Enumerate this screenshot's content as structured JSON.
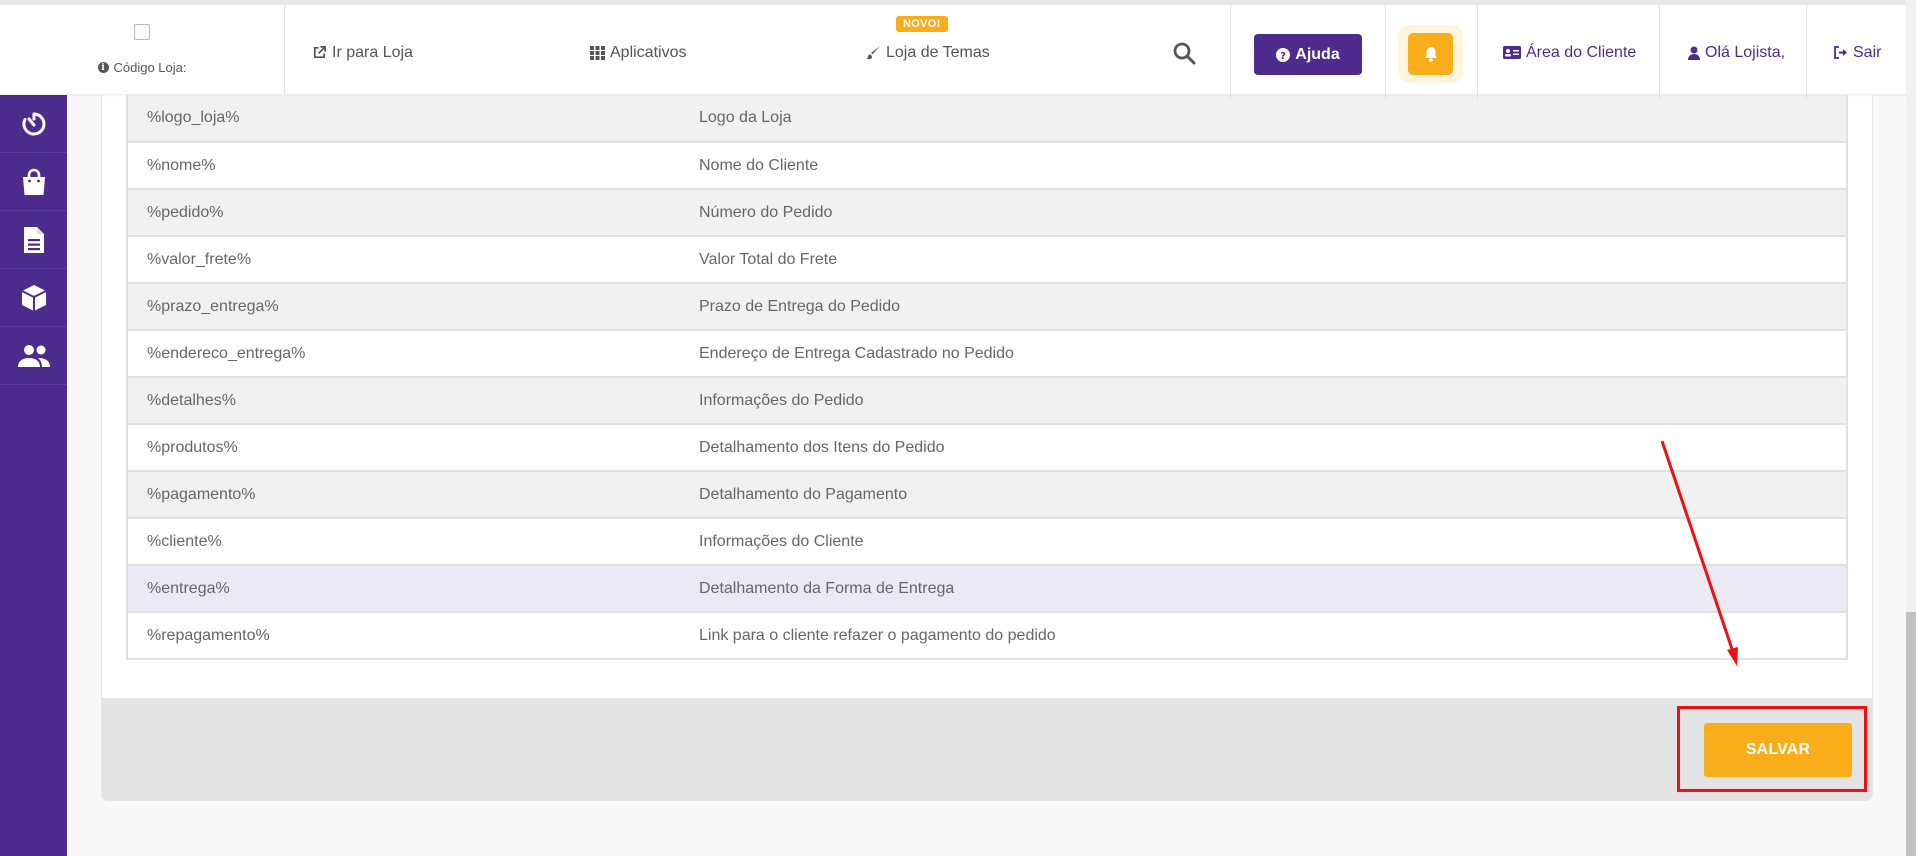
{
  "header": {
    "store_code_label": "Código Loja:",
    "nav": {
      "go_to_store": "Ir para Loja",
      "apps": "Aplicativos",
      "theme_store": "Loja de Temas",
      "theme_badge": "NOVO!",
      "help": "Ajuda",
      "client_area": "Área do Cliente",
      "greeting": "Olá Lojista,",
      "logout": "Sair"
    }
  },
  "sidebar": {
    "items": [
      {
        "icon": "timer-icon"
      },
      {
        "icon": "shopping-bag-icon"
      },
      {
        "icon": "document-icon"
      },
      {
        "icon": "box-icon"
      },
      {
        "icon": "users-icon"
      }
    ]
  },
  "variables_table": {
    "rows": [
      {
        "variable": "%logo_loja%",
        "description": "Logo da Loja"
      },
      {
        "variable": "%nome%",
        "description": "Nome do Cliente"
      },
      {
        "variable": "%pedido%",
        "description": "Número do Pedido"
      },
      {
        "variable": "%valor_frete%",
        "description": "Valor Total do Frete"
      },
      {
        "variable": "%prazo_entrega%",
        "description": "Prazo de Entrega do Pedido"
      },
      {
        "variable": "%endereco_entrega%",
        "description": "Endereço de Entrega Cadastrado no Pedido"
      },
      {
        "variable": "%detalhes%",
        "description": "Informações do Pedido"
      },
      {
        "variable": "%produtos%",
        "description": "Detalhamento dos Itens do Pedido"
      },
      {
        "variable": "%pagamento%",
        "description": "Detalhamento do Pagamento"
      },
      {
        "variable": "%cliente%",
        "description": "Informações do Cliente"
      },
      {
        "variable": "%entrega%",
        "description": "Detalhamento da Forma de Entrega"
      },
      {
        "variable": "%repagamento%",
        "description": "Link para o cliente refazer o pagamento do pedido"
      }
    ]
  },
  "footer": {
    "save_label": "SALVAR"
  },
  "colors": {
    "brand_purple": "#4e2c8e",
    "accent_orange": "#f9ad1b",
    "annotation_red": "#ee1111"
  }
}
